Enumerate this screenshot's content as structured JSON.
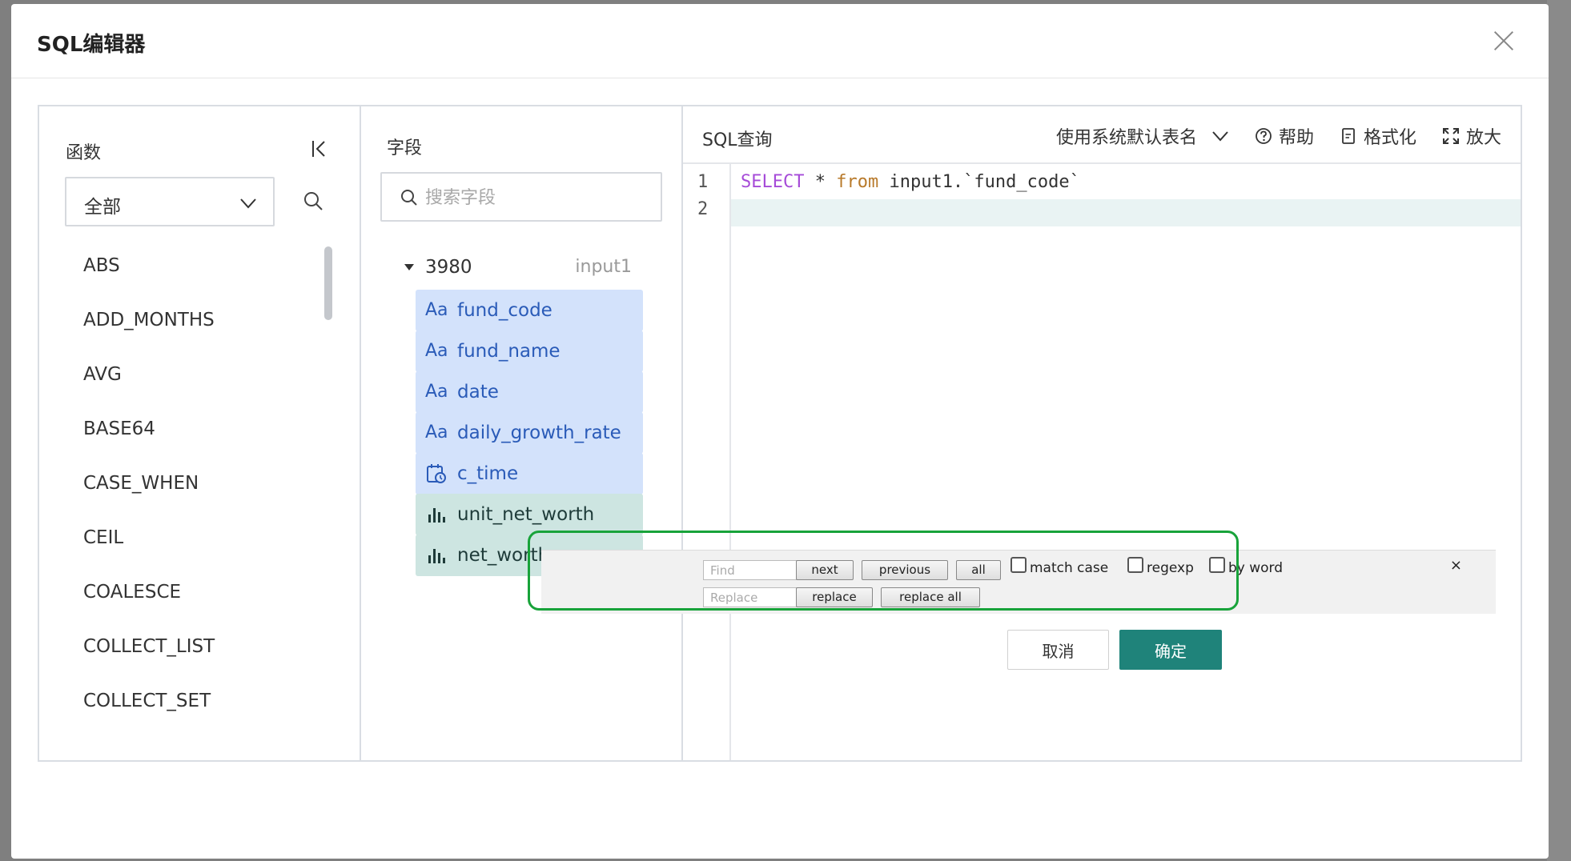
{
  "dialog": {
    "title": "SQL编辑器",
    "cancel_label": "取消",
    "ok_label": "确定"
  },
  "functions": {
    "title": "函数",
    "category_selected": "全部",
    "items": [
      "ABS",
      "ADD_MONTHS",
      "AVG",
      "BASE64",
      "CASE_WHEN",
      "CEIL",
      "COALESCE",
      "COLLECT_LIST",
      "COLLECT_SET"
    ]
  },
  "fields": {
    "title": "字段",
    "search_placeholder": "搜索字段",
    "dataset_name": "3980",
    "dataset_table": "input1",
    "items": [
      {
        "name": "fund_code",
        "type": "text",
        "icon": "Aa"
      },
      {
        "name": "fund_name",
        "type": "text",
        "icon": "Aa"
      },
      {
        "name": "date",
        "type": "text",
        "icon": "Aa"
      },
      {
        "name": "daily_growth_rate",
        "type": "text",
        "icon": "Aa"
      },
      {
        "name": "c_time",
        "type": "datetime",
        "icon": "calendar-clock-icon"
      },
      {
        "name": "unit_net_worth",
        "type": "measure",
        "icon": "bar-chart-icon"
      },
      {
        "name": "net_worth",
        "type": "measure",
        "icon": "bar-chart-icon"
      }
    ]
  },
  "sql": {
    "title": "SQL查询",
    "table_name_mode": "使用系统默认表名",
    "help_label": "帮助",
    "format_label": "格式化",
    "expand_label": "放大",
    "line_numbers": [
      "1",
      "2"
    ],
    "code": {
      "kw_select": "SELECT",
      "star": " * ",
      "kw_from": "from",
      "rest": " input1.`fund_code`"
    }
  },
  "find_replace": {
    "find_placeholder": "Find",
    "replace_placeholder": "Replace",
    "next_label": "next",
    "previous_label": "previous",
    "all_label": "all",
    "match_case_label": "match case",
    "regexp_label": "regexp",
    "by_word_label": "by word",
    "replace_label": "replace",
    "replace_all_label": "replace all",
    "close_glyph": "×"
  },
  "colors": {
    "primary": "#1f837a",
    "dimension_chip": "#d3e2fb",
    "measure_chip": "#cde5e1",
    "highlight_outline": "#18a33a",
    "keyword": "#a64bd8"
  }
}
